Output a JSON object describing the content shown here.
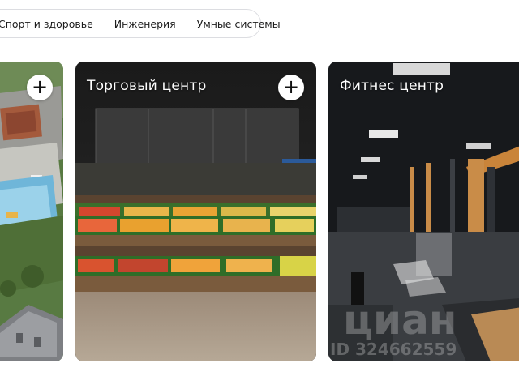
{
  "tabs": [
    "Спорт и здоровье",
    "Инженерия",
    "Умные системы"
  ],
  "cards": [
    {
      "title": "",
      "plus": "+"
    },
    {
      "title": "Торговый центр",
      "plus": "+"
    },
    {
      "title": "Фитнес центр"
    }
  ],
  "watermark": {
    "brand": "циан",
    "id": "ID 324662559"
  },
  "icons": {
    "add": "plus-icon"
  },
  "colors": {
    "tab_border": "#dcdde1",
    "card_text": "#ffffff",
    "button_bg": "#ffffff"
  }
}
